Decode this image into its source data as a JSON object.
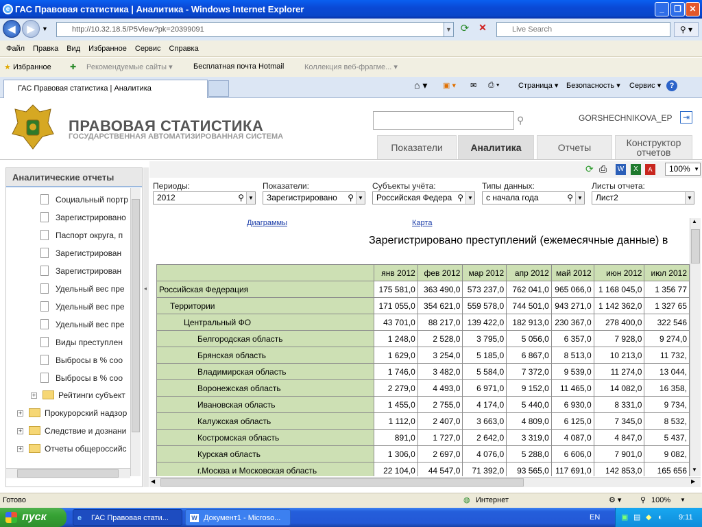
{
  "window": {
    "title": "ГАС Правовая статистика | Аналитика - Windows Internet Explorer"
  },
  "browser": {
    "url": "http://10.32.18.5/P5View?pk=20399091",
    "search_placeholder": "Live Search",
    "menu": [
      "Файл",
      "Правка",
      "Вид",
      "Избранное",
      "Сервис",
      "Справка"
    ],
    "favorites_label": "Избранное",
    "fav_links": [
      "Рекомендуемые сайты",
      "Бесплатная почта Hotmail",
      "Коллекция веб-фрагме..."
    ],
    "tab_title": "ГАС Правовая статистика | Аналитика",
    "commands": [
      "Страница",
      "Безопасность",
      "Сервис"
    ]
  },
  "app": {
    "title": "ПРАВОВАЯ СТАТИСТИКА",
    "subtitle": "ГОСУДАРСТВЕННАЯ АВТОМАТИЗИРОВАННАЯ СИСТЕМА",
    "user": "GORSHECHNIKOVA_EP",
    "tabs": [
      "Показатели",
      "Аналитика",
      "Отчеты",
      "Конструктор отчетов"
    ],
    "active_tab": "Аналитика"
  },
  "sidebar": {
    "title": "Аналитические отчеты",
    "docs": [
      "Социальный портр",
      "Зарегистрировано",
      "Паспорт округа, п",
      "Зарегистрирован",
      "Зарегистрирован",
      "Удельный вес пре",
      "Удельный вес пре",
      "Удельный вес пре",
      "Виды преступлен",
      "Выбросы в % соо",
      "Выбросы в % соо"
    ],
    "sub_folder": "Рейтинги субъект",
    "folders": [
      "Прокурорский надзор",
      "Следствие и дознани",
      "Отчеты общероссийс"
    ]
  },
  "toolbar": {
    "zoom": "100%"
  },
  "filters": [
    {
      "label": "Периоды:",
      "value": "2012"
    },
    {
      "label": "Показатели:",
      "value": "Зарегистрировано"
    },
    {
      "label": "Субъекты учёта:",
      "value": "Российская Федера"
    },
    {
      "label": "Типы данных:",
      "value": "с начала года"
    },
    {
      "label": "Листы отчета:",
      "value": "Лист2"
    }
  ],
  "report": {
    "link_charts": "Диаграммы",
    "link_map": "Карта",
    "title": "Зарегистрировано преступлений (ежемесячные данные) в",
    "columns": [
      "янв 2012",
      "фев 2012",
      "мар 2012",
      "апр 2012",
      "май 2012",
      "июн 2012",
      "июл 2012"
    ],
    "rows": [
      {
        "label": "Российская Федерация",
        "values": [
          "175 581,0",
          "363 490,0",
          "573 237,0",
          "762 041,0",
          "965 066,0",
          "1 168 045,0",
          "1 356 77"
        ]
      },
      {
        "label": "Территории",
        "values": [
          "171 055,0",
          "354 621,0",
          "559 578,0",
          "744 501,0",
          "943 271,0",
          "1 142 362,0",
          "1 327 65"
        ]
      },
      {
        "label": "Центральный ФО",
        "values": [
          "43 701,0",
          "88 217,0",
          "139 422,0",
          "182 913,0",
          "230 367,0",
          "278 400,0",
          "322 546"
        ]
      },
      {
        "label": "Белгородская область",
        "values": [
          "1 248,0",
          "2 528,0",
          "3 795,0",
          "5 056,0",
          "6 357,0",
          "7 928,0",
          "9 274,0"
        ]
      },
      {
        "label": "Брянская область",
        "values": [
          "1 629,0",
          "3 254,0",
          "5 185,0",
          "6 867,0",
          "8 513,0",
          "10 213,0",
          "11 732,"
        ]
      },
      {
        "label": "Владимирская область",
        "values": [
          "1 746,0",
          "3 482,0",
          "5 584,0",
          "7 372,0",
          "9 539,0",
          "11 274,0",
          "13 044,"
        ]
      },
      {
        "label": "Воронежская область",
        "values": [
          "2 279,0",
          "4 493,0",
          "6 971,0",
          "9 152,0",
          "11 465,0",
          "14 082,0",
          "16 358,"
        ]
      },
      {
        "label": "Ивановская область",
        "values": [
          "1 455,0",
          "2 755,0",
          "4 174,0",
          "5 440,0",
          "6 930,0",
          "8 331,0",
          "9 734,"
        ]
      },
      {
        "label": "Калужская область",
        "values": [
          "1 112,0",
          "2 407,0",
          "3 663,0",
          "4 809,0",
          "6 125,0",
          "7 345,0",
          "8 532,"
        ]
      },
      {
        "label": "Костромская область",
        "values": [
          "891,0",
          "1 727,0",
          "2 642,0",
          "3 319,0",
          "4 087,0",
          "4 847,0",
          "5 437,"
        ]
      },
      {
        "label": "Курская область",
        "values": [
          "1 306,0",
          "2 697,0",
          "4 076,0",
          "5 288,0",
          "6 606,0",
          "7 901,0",
          "9 082,"
        ]
      },
      {
        "label": "г.Москва и Московская область",
        "values": [
          "22 104,0",
          "44 547,0",
          "71 392,0",
          "93 565,0",
          "117 691,0",
          "142 853,0",
          "165 656"
        ]
      }
    ]
  },
  "status": {
    "text": "Готово",
    "zone": "Интернет",
    "zoom": "100%"
  },
  "taskbar": {
    "start": "пуск",
    "tasks": [
      "ГАС Правовая стати...",
      "Документ1 - Microso..."
    ],
    "lang": "EN",
    "time": "9:11"
  }
}
